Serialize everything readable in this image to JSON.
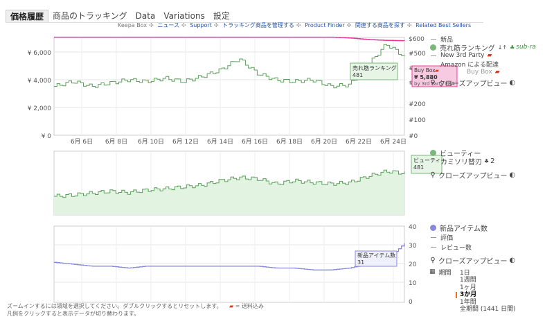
{
  "tabs": [
    {
      "label": "価格履歴",
      "active": true
    },
    {
      "label": "商品のトラッキング",
      "active": false
    },
    {
      "label": "Data",
      "active": false
    },
    {
      "label": "Variations",
      "active": false
    },
    {
      "label": "設定",
      "active": false
    }
  ],
  "links": {
    "prefix": "Keepa Box",
    "items": [
      "ニュース",
      "Support",
      "トラッキング商品を管理する",
      "Product Finder",
      "関連する商品を探す",
      "Related Best Sellers"
    ]
  },
  "chart1": {
    "left_ticks": [
      "¥ 6,000",
      "¥ 4,000",
      "¥ 2,000",
      "¥ 0"
    ],
    "right_ticks": [
      "$600",
      "#500",
      "#400",
      "#300",
      "#200",
      "#100",
      "#0"
    ],
    "x_ticks": [
      "6月 6日",
      "6月 8日",
      "6月 10日",
      "6月 12日",
      "6月 14日",
      "6月 16日",
      "6月 18日",
      "6月 20日",
      "6月 22日",
      "6月 24日"
    ],
    "tooltip_rank": {
      "label": "売れ筋ランキング",
      "value": "481"
    },
    "tooltip_buybox": {
      "title": "Buy Box",
      "price": "¥ 5,880",
      "by": "by 3rd Party FBA"
    }
  },
  "chart2": {
    "tooltip": {
      "label": "ビューティー",
      "value": "481"
    }
  },
  "chart3": {
    "right_ticks": [
      "40",
      "30",
      "20",
      "10",
      "0"
    ],
    "tooltip": {
      "label": "新品アイテム数",
      "value": "31"
    }
  },
  "legend1": {
    "new": "新品",
    "rank": "売れ筋ランキング",
    "sub": "sub-ra",
    "third_party": "New 3rd Party",
    "amazon_ship": "Amazon による配達",
    "buybox": "Buy Box",
    "closeup": "クローズアップビュー"
  },
  "legend2": {
    "beauty": "ビューティー",
    "razor": "カミソリ替刃",
    "razor_count": "2",
    "closeup": "クローズアップビュー"
  },
  "legend3": {
    "new_count": "新品アイテム数",
    "rating": "評価",
    "reviews": "レビュー数",
    "closeup": "クローズアップビュー"
  },
  "period": {
    "label": "期間",
    "options": [
      "1日",
      "1週間",
      "1ヶ月",
      "3か月",
      "1年間",
      "全期間 (1441 日間)"
    ],
    "selected": "3か月"
  },
  "footer": {
    "line1": "ズームインするには領域を選択してください。ダブルクリックするとリセットします。",
    "ship": "= 送料込み",
    "line2": "凡例をクリックすると表示データが切り替わります。"
  },
  "colors": {
    "price_line": "#e8359a",
    "rank_line": "#5aa05a",
    "rank_fill": "#e2f3e2",
    "offer_line": "#8888dd",
    "tooltip_bg": "#e6f5e6",
    "buybox_bg": "#f8c8e0"
  },
  "chart_data": [
    {
      "type": "line",
      "series": [
        {
          "name": "Buy Box",
          "values": [
            6100,
            6100,
            6100,
            6100,
            6100,
            6100,
            6100,
            6100,
            6100,
            6100,
            6100,
            6100,
            6100,
            6100,
            6100,
            6100,
            6050,
            5950,
            5900,
            5880
          ]
        },
        {
          "name": "売れ筋ランキング",
          "values": [
            300,
            330,
            300,
            320,
            340,
            330,
            350,
            330,
            360,
            400,
            470,
            380,
            340,
            330,
            340,
            300,
            310,
            430,
            560,
            481
          ]
        }
      ]
    },
    {
      "type": "area",
      "series": [
        {
          "name": "ビューティー",
          "values": [
            30,
            32,
            35,
            38,
            36,
            40,
            42,
            45,
            48,
            55,
            60,
            58,
            50,
            55,
            52,
            50,
            52,
            62,
            70,
            67
          ]
        }
      ]
    },
    {
      "type": "line",
      "series": [
        {
          "name": "新品アイテム数",
          "values": [
            21,
            20,
            19,
            19,
            18,
            19,
            19,
            19,
            19,
            19,
            19,
            19,
            18,
            18,
            17,
            17,
            18,
            20,
            22,
            31
          ]
        }
      ]
    }
  ]
}
